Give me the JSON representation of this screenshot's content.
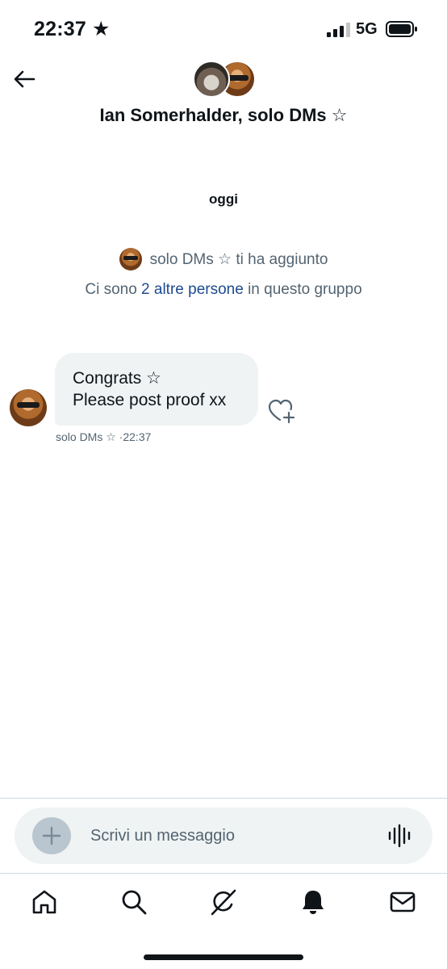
{
  "status_bar": {
    "time": "22:37",
    "star": "★",
    "network": "5G"
  },
  "header": {
    "back_icon": "arrow-left-icon",
    "title": "Ian Somerhalder, solo DMs ☆"
  },
  "conversation": {
    "date_label": "oggi",
    "added_by": "solo DMs ☆",
    "added_text": "ti ha aggiunto",
    "group_info_prefix": "Ci sono",
    "group_info_link": "2 altre persone",
    "group_info_suffix": "in questo gruppo",
    "messages": [
      {
        "lines": [
          "Congrats ☆",
          "Please post proof xx"
        ],
        "sender": "solo DMs ☆",
        "time": "22:37"
      }
    ]
  },
  "composer": {
    "placeholder": "Scrivi un messaggio"
  },
  "tabs": [
    "home-icon",
    "search-icon",
    "grok-icon",
    "notifications-icon",
    "messages-icon"
  ],
  "colors": {
    "accent_link": "#1d4b8f",
    "secondary_text": "#536471",
    "bubble": "#eff3f4",
    "primary_text": "#0f1419"
  }
}
